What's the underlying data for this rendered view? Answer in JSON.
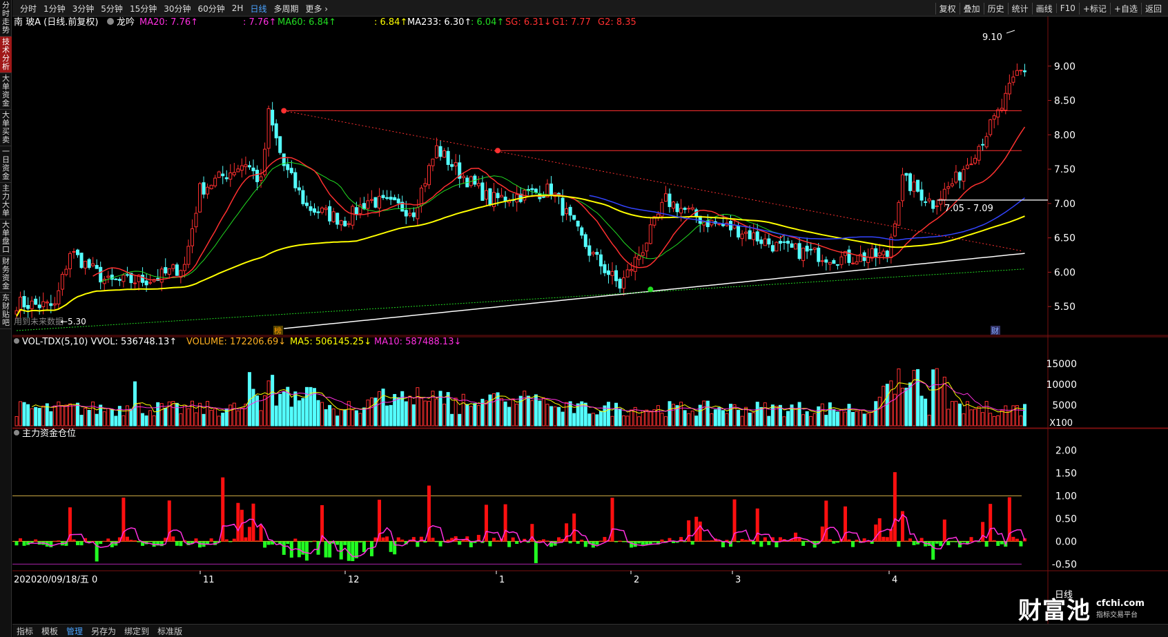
{
  "sidebar": {
    "items": [
      {
        "label": "分时走势",
        "active": false
      },
      {
        "label": "技术分析",
        "active": true
      },
      {
        "label": "大单资金",
        "active": false
      },
      {
        "label": "大单买卖",
        "active": false
      },
      {
        "label": "一日资金",
        "active": false
      },
      {
        "label": "主力大单",
        "active": false
      },
      {
        "label": "大单盘口",
        "active": false
      },
      {
        "label": "财务资金",
        "active": false
      },
      {
        "label": "东财贴吧",
        "active": false
      }
    ]
  },
  "toolbar": {
    "left": [
      "分时",
      "1分钟",
      "3分钟",
      "5分钟",
      "15分钟",
      "30分钟",
      "60分钟",
      "2H",
      "日线",
      "多周期",
      "更多 ›"
    ],
    "active": "日线",
    "right": [
      "复权",
      "叠加",
      "历史",
      "统计",
      "画线",
      "F10",
      "+标记",
      "+自选",
      "返回"
    ]
  },
  "header": {
    "stock": "南 玻A (日线.前复权)",
    "indicator_name": "龙吟",
    "items": [
      {
        "text": "MA20: 7.76↑",
        "color": "#ff2fe0"
      },
      {
        "text": ": 7.76↑",
        "color": "#ff2fe0"
      },
      {
        "text": "MA60: 6.84↑",
        "color": "#22dd22"
      },
      {
        "text": ": 6.84↑",
        "color": "#ffff00"
      },
      {
        "text": "MA233: 6.30↑",
        "color": "#ffffff"
      },
      {
        "text": ": 6.04↑",
        "color": "#22dd22"
      },
      {
        "text": "SG: 6.31↓",
        "color": "#ff3030"
      },
      {
        "text": "G1: 7.77",
        "color": "#ff3030"
      },
      {
        "text": "G2: 8.35",
        "color": "#ff3030"
      }
    ]
  },
  "vol_header": {
    "items": [
      {
        "text": "VOL-TDX(5,10) VVOL: 536748.13↑",
        "color": "#ffffff"
      },
      {
        "text": "VOLUME: 172206.69↓",
        "color": "#ffb020"
      },
      {
        "text": "MA5: 506145.25↓",
        "color": "#ffff00"
      },
      {
        "text": "MA10: 587488.13↓",
        "color": "#ff2fe0"
      }
    ]
  },
  "fund_header": {
    "text": "主力资金仓位"
  },
  "annotations": {
    "high_label": "9.10",
    "range_label": "7.05 - 7.09",
    "low_label": "5.30",
    "future_text": "用到未来数据",
    "marker_bang": "榜",
    "marker_cai": "财"
  },
  "x_axis": {
    "start_label": "202020/09/18/五 0",
    "months": [
      "11",
      "12",
      "1",
      "2",
      "3",
      "4"
    ],
    "end_label": "日线"
  },
  "bottom_bar": {
    "items": [
      "指标",
      "模板",
      "管理",
      "另存为",
      "绑定到",
      "标准版"
    ],
    "active": "管理"
  },
  "watermark": {
    "big": "财富池",
    "url": "cfchi.com",
    "sub": "指标交易平台"
  },
  "colors": {
    "up": "#ff3030",
    "down": "#54ffff",
    "ma20": "#ff2fe0",
    "ma60": "#22dd22",
    "ma_yellow": "#ffff00",
    "ma233": "#ffffff",
    "ma_blue": "#3344ff",
    "fund_up": "#ff1010",
    "fund_down": "#22ff22"
  },
  "chart_data": {
    "type": "candlestick",
    "title": "南玻A 日线 前复权",
    "price_axis": {
      "ticks": [
        9.0,
        8.5,
        8.0,
        7.5,
        7.0,
        6.5,
        6.0,
        5.5
      ],
      "range": [
        5.1,
        9.5
      ]
    },
    "volume_axis": {
      "ticks": [
        15000,
        10000,
        5000
      ],
      "unit": "X100",
      "range": [
        0,
        18500
      ]
    },
    "fund_axis": {
      "ticks": [
        2.0,
        1.5,
        1.0,
        0.5,
        0.0,
        -0.5
      ],
      "range": [
        -0.6,
        2.25
      ]
    },
    "levels": [
      {
        "name": "G2",
        "value": 8.35
      },
      {
        "name": "G1",
        "value": 7.77
      },
      {
        "name": "range",
        "value": 7.05
      }
    ],
    "points": {
      "high_marker": 8.35,
      "mid_marker": 7.77,
      "low_marker": 5.75,
      "top_price": 9.1,
      "bottom_price": 5.3
    }
  }
}
